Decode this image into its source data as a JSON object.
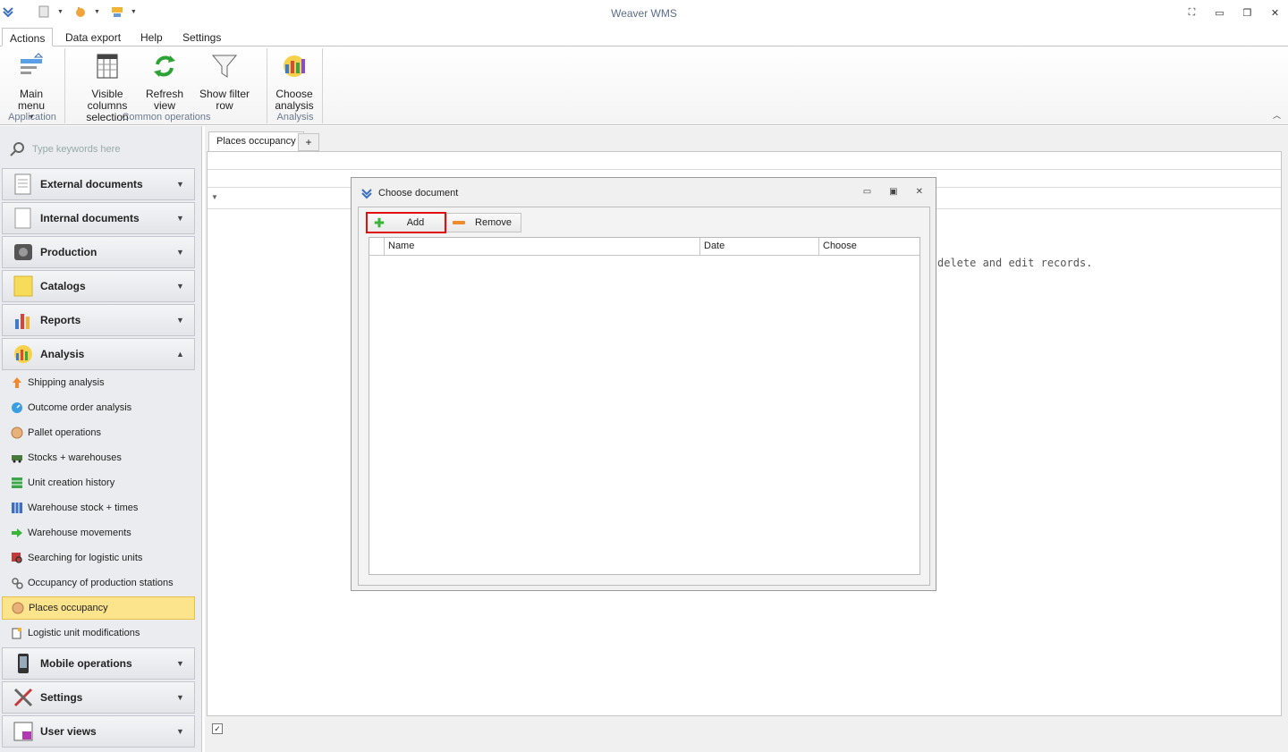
{
  "app": {
    "title": "Weaver WMS"
  },
  "ribbon_tabs": [
    "Actions",
    "Data export",
    "Help",
    "Settings"
  ],
  "ribbon": {
    "main_menu": "Main menu",
    "visible_columns": [
      "Visible columns",
      "selection"
    ],
    "refresh_view": [
      "Refresh",
      "view"
    ],
    "show_filter_row": "Show filter row",
    "choose_analysis": [
      "Choose",
      "analysis"
    ],
    "groups": {
      "application": "Application",
      "common": "Common operations",
      "analysis": "Analysis"
    }
  },
  "search": {
    "placeholder": "Type keywords here"
  },
  "nav_groups": {
    "external_documents": "External documents",
    "internal_documents": "Internal documents",
    "production": "Production",
    "catalogs": "Catalogs",
    "reports": "Reports",
    "analysis": "Analysis",
    "mobile_operations": "Mobile operations",
    "settings": "Settings",
    "user_views": "User views"
  },
  "analysis_items": [
    "Shipping analysis",
    "Outcome order analysis",
    "Pallet operations",
    "Stocks + warehouses",
    "Unit creation history",
    "Warehouse stock + times",
    "Warehouse movements",
    "Searching for logistic units",
    "Occupancy of production stations",
    "Places occupancy",
    "Logistic unit modifications"
  ],
  "document_tab": {
    "label": "Places occupancy",
    "add": "+"
  },
  "empty_message": "delete and edit records.",
  "footer": {
    "checkbox": "✓"
  },
  "dialog": {
    "title": "Choose document",
    "add_label": "Add",
    "remove_label": "Remove",
    "columns": [
      "Name",
      "Date",
      "Choose"
    ]
  },
  "colors": {
    "selected_bg": "#fce48c",
    "highlight_outline": "#e01010",
    "title_text": "#5a6d8a"
  }
}
